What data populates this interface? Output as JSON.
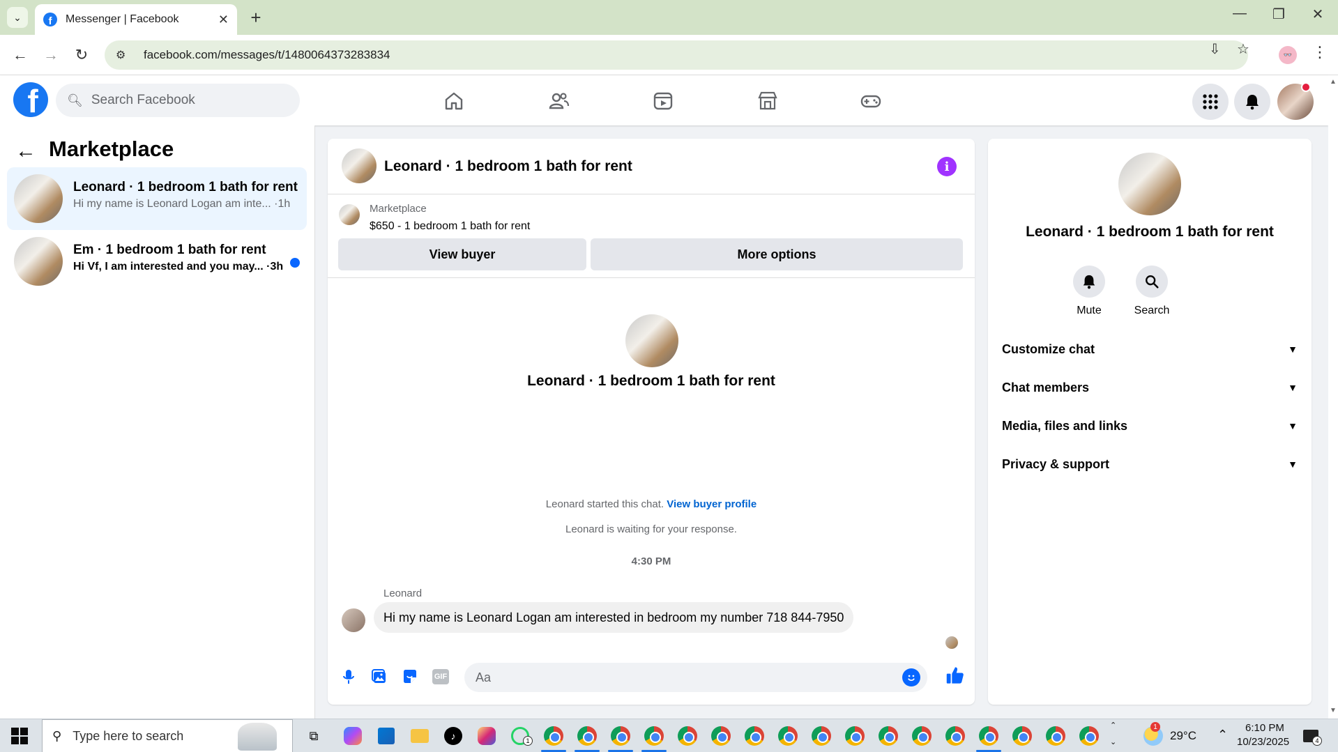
{
  "browser": {
    "tab_title": "Messenger | Facebook",
    "url": "facebook.com/messages/t/1480064373283834"
  },
  "fb": {
    "search_placeholder": "Search Facebook"
  },
  "left": {
    "title": "Marketplace",
    "conversations": [
      {
        "name": "Leonard · 1 bedroom 1 bath for rent",
        "preview": "Hi my name is Leonard Logan am inte... ·1h",
        "active": true
      },
      {
        "name": "Em · 1 bedroom 1 bath for rent",
        "preview": "Hi Vf, I am interested and you may... ·3h",
        "unread": true
      }
    ]
  },
  "chat": {
    "title": "Leonard · 1 bedroom 1 bath for rent",
    "marketplace_label": "Marketplace",
    "listing": "$650 - 1 bedroom 1 bath for rent",
    "view_buyer": "View buyer",
    "more_options": "More options",
    "center_title": "Leonard · 1 bedroom 1 bath for rent",
    "started_text": "Leonard started this chat.",
    "view_profile_link": "View buyer profile",
    "waiting_text": "Leonard is waiting for your response.",
    "time": "4:30 PM",
    "sender": "Leonard",
    "message": "Hi my name is Leonard Logan am interested in bedroom my number 718 844-7950",
    "composer_placeholder": "Aa"
  },
  "right": {
    "title": "Leonard · 1 bedroom 1 bath for rent",
    "mute_label": "Mute",
    "search_label": "Search",
    "sections": [
      "Customize chat",
      "Chat members",
      "Media, files and links",
      "Privacy & support"
    ]
  },
  "taskbar": {
    "search_placeholder": "Type here to search",
    "whatsapp_badge": "1",
    "temperature": "29°C",
    "time": "6:10 PM",
    "date": "10/23/2025",
    "notification_count": "4",
    "weather_badge": "1"
  },
  "colors": {
    "fb_blue": "#1877f2",
    "accent_purple": "#a033ff",
    "unread_blue": "#0866ff"
  }
}
